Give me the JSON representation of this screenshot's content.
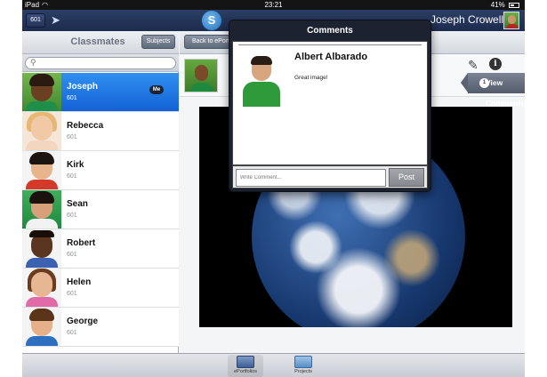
{
  "status_bar": {
    "carrier": "iPad",
    "time": "23:21",
    "battery": "41%"
  },
  "top_bar": {
    "class_button": "601",
    "user_name": "Joseph Crowell"
  },
  "sidebar": {
    "title": "Classmates",
    "subjects_button": "Subjects",
    "search_placeholder": "",
    "students": [
      {
        "name": "Joseph",
        "class": "601",
        "badge": "Me",
        "selected": true
      },
      {
        "name": "Rebecca",
        "class": "601"
      },
      {
        "name": "Kirk",
        "class": "601"
      },
      {
        "name": "Sean",
        "class": "601"
      },
      {
        "name": "Robert",
        "class": "601"
      },
      {
        "name": "Helen",
        "class": "601"
      },
      {
        "name": "George",
        "class": "601"
      }
    ]
  },
  "main": {
    "back_button": "Back to ePortfolios",
    "view_comments": {
      "label": "View Comments",
      "count": "1"
    }
  },
  "comments_popover": {
    "title": "Comments",
    "comments": [
      {
        "author": "Albert Albarado",
        "text": "Great image!"
      }
    ],
    "input_placeholder": "Write Comment...",
    "post_button": "Post"
  },
  "tab_bar": {
    "tabs": [
      {
        "label": "ePortfolios",
        "active": true
      },
      {
        "label": "Projects",
        "active": false
      }
    ]
  },
  "colors": {
    "selected_row": "#1f76e3",
    "top_bar": "#24365c"
  }
}
